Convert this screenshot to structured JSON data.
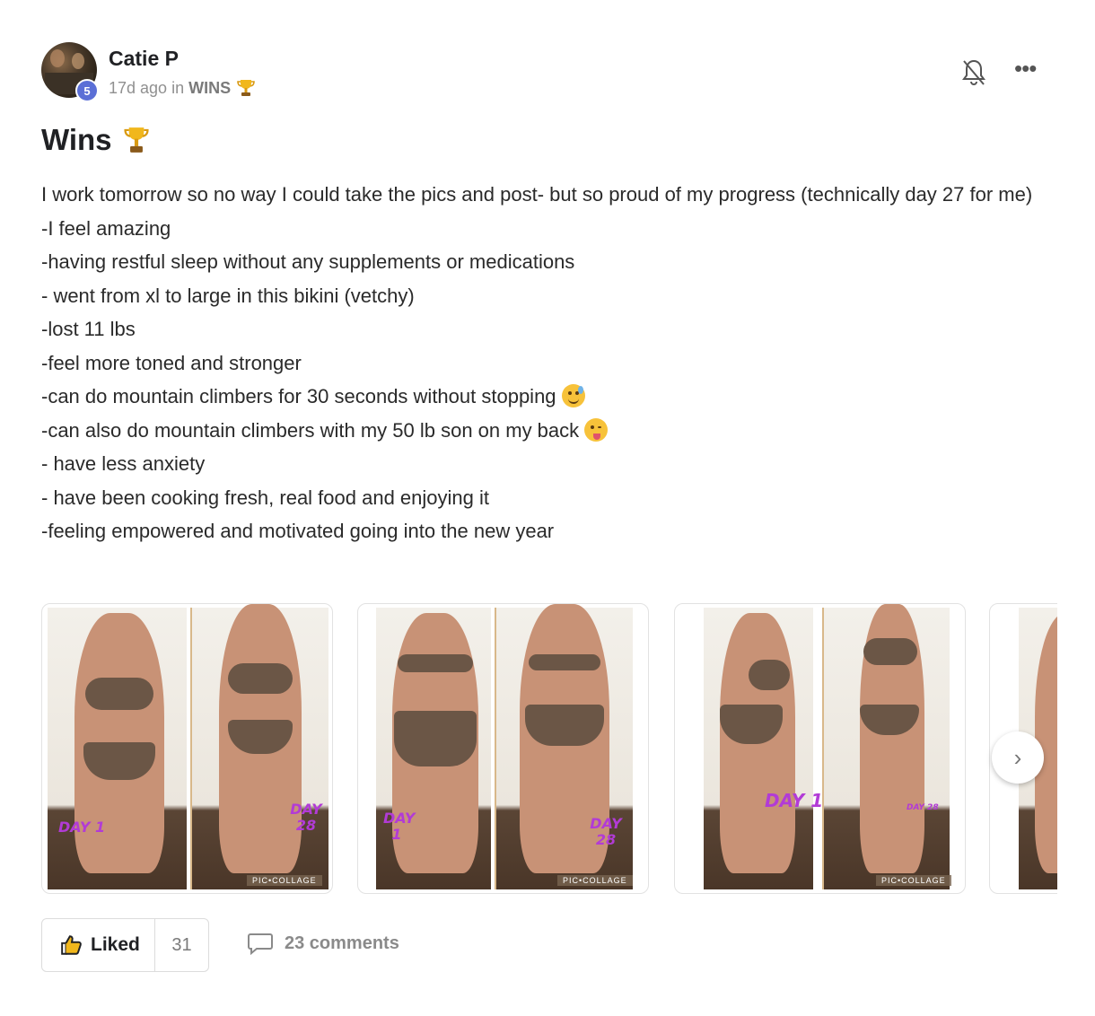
{
  "post": {
    "author": "Catie P",
    "level": "5",
    "time_ago": "17d ago in",
    "category": "WINS",
    "title": "Wins",
    "body_lines": [
      "I work tomorrow so no way I could take the pics and post- but so proud of my progress (technically day 27 for me)",
      "-I feel amazing",
      "-having restful sleep without any supplements or medications",
      "- went from xl to large in this bikini (vetchy)",
      "-lost 11 lbs",
      "-feel more toned and stronger",
      "-can do mountain climbers for 30 seconds without stopping",
      "-can also do mountain climbers with my 50 lb son on my back",
      "- have less anxiety",
      "- have been cooking fresh, real food and enjoying it",
      "-feeling empowered and motivated going into the new year"
    ],
    "images": [
      {
        "left_label": "DAY 1",
        "right_label": "DAY 28",
        "watermark": "PIC•COLLAGE"
      },
      {
        "left_label": "DAY 1",
        "right_label": "DAY 28",
        "watermark": "PIC•COLLAGE"
      },
      {
        "left_label": "DAY 1",
        "right_label": "DAY 28",
        "watermark": "PIC•COLLAGE"
      }
    ],
    "like_label": "Liked",
    "like_count": "31",
    "comments_label": "23 comments"
  },
  "icons": {
    "trophy": "trophy-icon",
    "bell": "bell-off-icon",
    "more": "more-icon",
    "like": "thumbs-up-icon",
    "comment": "comment-icon",
    "next": "chevron-right-icon"
  },
  "colors": {
    "level_badge": "#5b6fd6",
    "day_label": "#b23bd6"
  }
}
